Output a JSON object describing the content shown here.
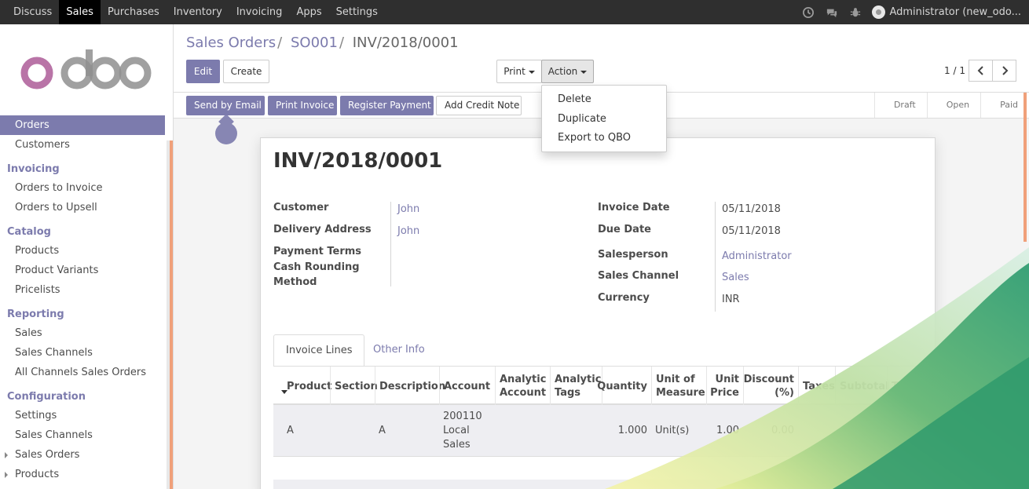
{
  "topnav": {
    "items": [
      {
        "label": "Discuss",
        "active": false
      },
      {
        "label": "Sales",
        "active": true
      },
      {
        "label": "Purchases",
        "active": false
      },
      {
        "label": "Inventory",
        "active": false
      },
      {
        "label": "Invoicing",
        "active": false
      },
      {
        "label": "Apps",
        "active": false
      },
      {
        "label": "Settings",
        "active": false
      }
    ],
    "icons": [
      "clock-icon",
      "chat-icon",
      "bug-icon"
    ],
    "user": "Administrator (new_odo..."
  },
  "sidebar": {
    "logo_text": "odoo",
    "items": [
      {
        "label": "Orders"
      },
      {
        "label": "Customers"
      },
      {
        "label": "Invoicing"
      },
      {
        "label": "Orders to Invoice"
      },
      {
        "label": "Orders to Upsell"
      },
      {
        "label": "Catalog"
      },
      {
        "label": "Products"
      },
      {
        "label": "Product Variants"
      },
      {
        "label": "Pricelists"
      },
      {
        "label": "Reporting"
      },
      {
        "label": "Sales"
      },
      {
        "label": "Sales Channels"
      },
      {
        "label": "All Channels Sales Orders"
      },
      {
        "label": "Configuration"
      },
      {
        "label": "Settings"
      },
      {
        "label": "Sales Channels"
      },
      {
        "label": "Sales Orders"
      },
      {
        "label": "Products"
      }
    ]
  },
  "breadcrumb": {
    "parts": [
      "Sales Orders",
      "SO001",
      "INV/2018/0001"
    ],
    "separator": "/"
  },
  "toolbar": {
    "edit": "Edit",
    "create": "Create",
    "print": "Print",
    "action": "Action",
    "pager": "1 / 1"
  },
  "action_menu": [
    "Delete",
    "Duplicate",
    "Export to QBO"
  ],
  "statusbar": {
    "buttons": [
      "Send by Email",
      "Print Invoice",
      "Register Payment",
      "Add Credit Note"
    ],
    "stages": [
      "Draft",
      "Open",
      "Paid"
    ]
  },
  "invoice": {
    "number": "INV/2018/0001",
    "left": [
      {
        "label": "Customer",
        "value": "John"
      },
      {
        "label": "Delivery Address",
        "value": "John"
      },
      {
        "label": "Payment Terms",
        "value": ""
      },
      {
        "label": "Cash Rounding Method",
        "value": ""
      }
    ],
    "right": [
      {
        "label": "Invoice Date",
        "value": "05/11/2018"
      },
      {
        "label": "Due Date",
        "value": "05/11/2018"
      },
      {
        "label": "Salesperson",
        "value": "Administrator"
      },
      {
        "label": "Sales Channel",
        "value": "Sales"
      },
      {
        "label": "Currency",
        "value": "INR"
      }
    ],
    "tabs": [
      "Invoice Lines",
      "Other Info"
    ],
    "columns": [
      "Product",
      "Section",
      "Description",
      "Account",
      "Analytic Account",
      "Analytic Tags",
      "Quantity",
      "Unit of Measure",
      "Unit Price",
      "Discount (%)",
      "Taxes",
      "Subtotal",
      "Tot"
    ],
    "rows": [
      {
        "product": "A",
        "section": "",
        "description": "A",
        "account": "200110 Local Sales",
        "analytic_account": "",
        "analytic_tags": "",
        "quantity": "1.000",
        "uom": "Unit(s)",
        "unit_price": "1.00",
        "discount": "0.00",
        "taxes": "",
        "subtotal": "1.0",
        "total": ""
      }
    ]
  },
  "colors": {
    "brand": "#7c7bad",
    "topbar": "#2f2f2f",
    "accent_scroll": "#f0a07a"
  }
}
